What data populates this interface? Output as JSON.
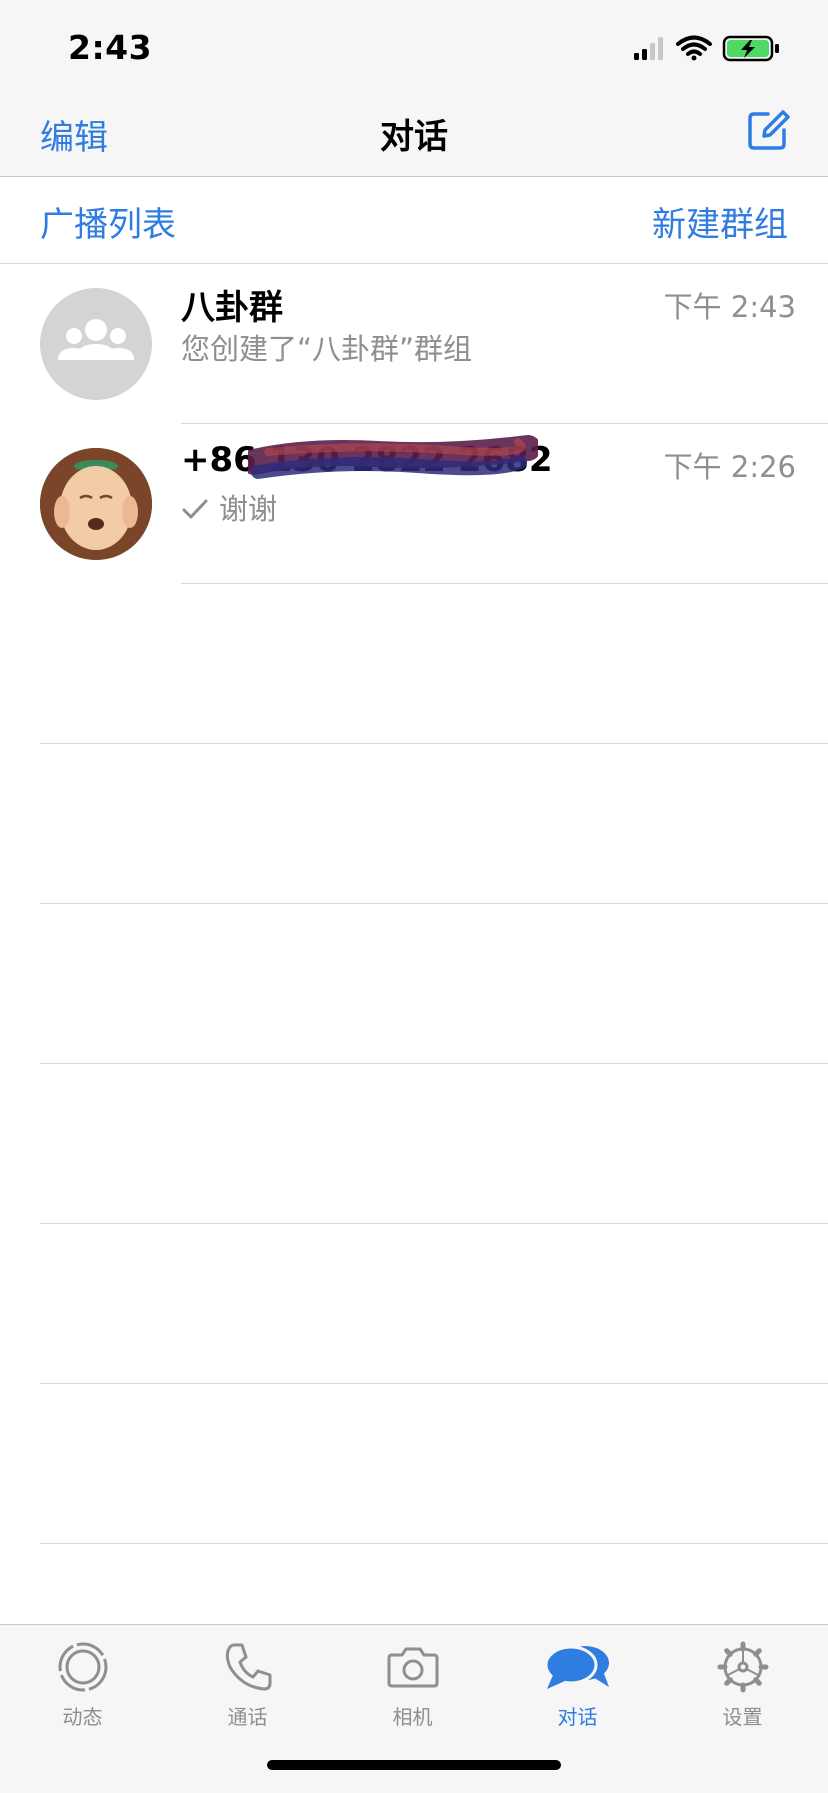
{
  "status_bar": {
    "time": "2:43"
  },
  "nav": {
    "edit_label": "编辑",
    "title": "对话",
    "compose_icon": "compose-icon"
  },
  "subbar": {
    "broadcast_label": "广播列表",
    "new_group_label": "新建群组"
  },
  "chats": [
    {
      "name": "八卦群",
      "time": "下午 2:43",
      "preview": "您创建了“八卦群”群组",
      "avatar": "group-avatar"
    },
    {
      "name": "+86 130 2822 2682",
      "time": "下午 2:26",
      "preview": "谢谢",
      "status_icon": "checkmark-icon",
      "avatar": "contact-photo"
    }
  ],
  "tabs": [
    {
      "label": "动态",
      "icon": "status-ring-icon"
    },
    {
      "label": "通话",
      "icon": "phone-icon"
    },
    {
      "label": "相机",
      "icon": "camera-icon"
    },
    {
      "label": "对话",
      "icon": "chats-bubble-icon",
      "active": true
    },
    {
      "label": "设置",
      "icon": "gear-icon"
    }
  ],
  "colors": {
    "accent": "#2f7de1",
    "secondary_text": "#8e8e93",
    "battery_green": "#4cd964"
  }
}
